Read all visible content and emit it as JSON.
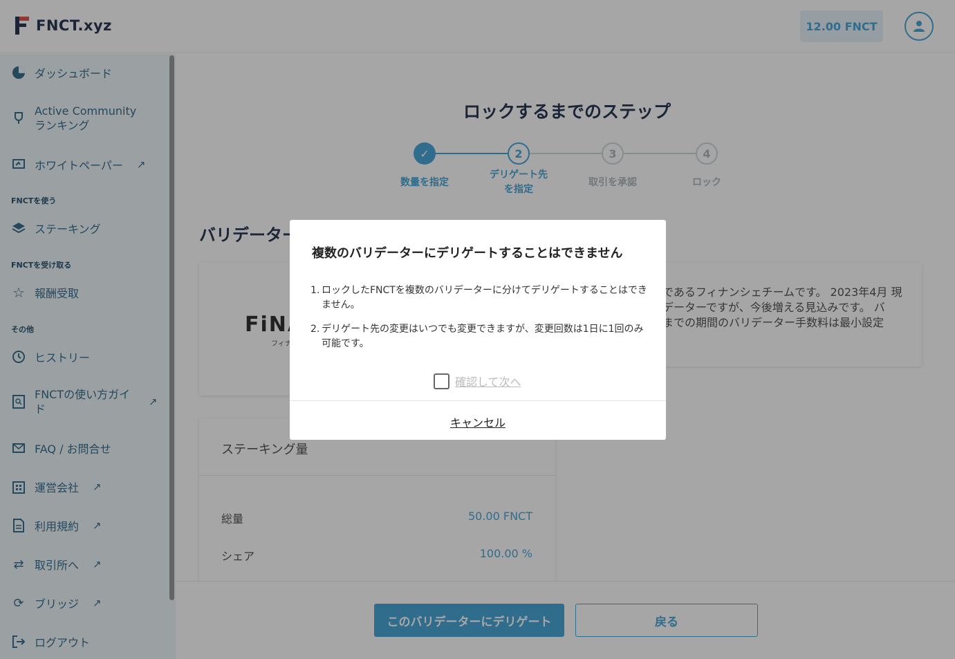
{
  "header": {
    "logo_text": "FNCT.xyz",
    "balance": "12.00 FNCT"
  },
  "sidebar": {
    "items": [
      {
        "label": "ダッシュボード",
        "icon": "pie-chart-icon"
      },
      {
        "label": "Active Community",
        "label2": "ランキング",
        "icon": "trophy-icon"
      },
      {
        "label": "ホワイトペーパー",
        "icon": "document-hand-icon",
        "external": "↗"
      },
      {
        "label": "ステーキング",
        "icon": "layers-icon"
      },
      {
        "label": "報酬受取",
        "icon": "star-icon"
      },
      {
        "label": "ヒストリー",
        "icon": "history-icon"
      },
      {
        "label": "FNCTの使い方ガイ",
        "label2": "ド",
        "icon": "guide-search-icon",
        "external": "↗"
      },
      {
        "label": "FAQ / お問合せ",
        "icon": "mail-icon"
      },
      {
        "label": "運営会社",
        "icon": "building-icon",
        "external": "↗"
      },
      {
        "label": "利用規約",
        "icon": "file-text-icon",
        "external": "↗"
      },
      {
        "label": "取引所へ",
        "icon": "exchange-icon",
        "external": "↗"
      },
      {
        "label": "ブリッジ",
        "icon": "refresh-icon",
        "external": "↗"
      },
      {
        "label": "ログアウト",
        "icon": "logout-icon"
      }
    ],
    "sections": {
      "use": "FNCTを使う",
      "receive": "FNCTを受け取る",
      "other": "その他"
    }
  },
  "main": {
    "title": "ロックするまでのステップ",
    "steps": [
      {
        "num": "✓",
        "label": "数量を指定",
        "state": "done"
      },
      {
        "num": "2",
        "label": "デリゲート先",
        "label2": "を指定",
        "state": "active"
      },
      {
        "num": "3",
        "label": "取引を承認",
        "state": "pending"
      },
      {
        "num": "4",
        "label": "ロック",
        "state": "pending"
      }
    ],
    "section_heading": "バリデーター",
    "validator_logo": "FiNA",
    "validator_sub": "フィナ",
    "description_lines": [
      "であるフィナンシェチームです。 2023年4月 現",
      "データーですが、今後増える見込みです。 バ",
      "までの期間のバリデーター手数料は最小設定"
    ],
    "stake": {
      "title": "ステーキング量",
      "rows": [
        {
          "label": "総量",
          "value": "50.00 FNCT"
        },
        {
          "label": "シェア",
          "value": "100.00 %"
        }
      ]
    },
    "buttons": {
      "delegate": "このバリデーターにデリゲート",
      "back": "戻る"
    }
  },
  "modal": {
    "title": "複数のバリデーターにデリゲートすることはできません",
    "items": [
      {
        "num": "1.",
        "text": "ロックしたFNCTを複数のバリデーターに分けてデリゲートすることはできません。"
      },
      {
        "num": "2.",
        "text": "デリゲート先の変更はいつでも変更できますが、変更回数は1日に1回のみ可能です。"
      }
    ],
    "confirm_label": "確認して次へ",
    "cancel_label": "キャンセル"
  },
  "colors": {
    "accent": "#4aa8d8",
    "navy": "#2b3a55",
    "brand_red": "#e2574c"
  }
}
